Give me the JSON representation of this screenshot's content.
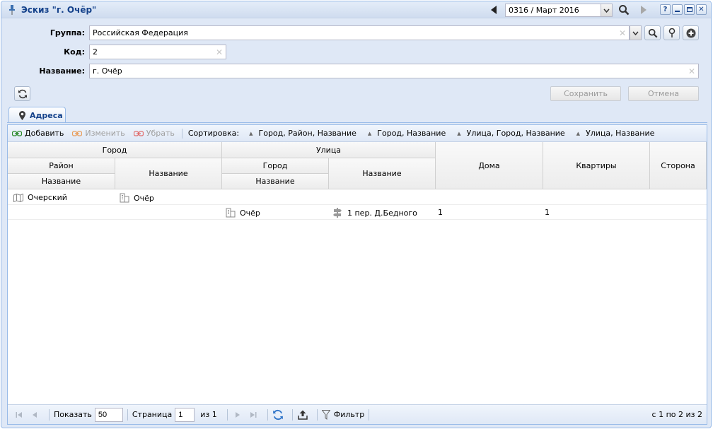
{
  "window": {
    "title": "Эскиз \"г. Очёр\"",
    "period": "0316 / Март 2016"
  },
  "form": {
    "group_label": "Группа:",
    "group_value": "Российская Федерация",
    "code_label": "Код:",
    "code_value": "2",
    "name_label": "Название:",
    "name_value": "г. Очёр",
    "save_label": "Сохранить",
    "cancel_label": "Отмена"
  },
  "tab": {
    "label": "Адреса"
  },
  "toolbar": {
    "add": "Добавить",
    "edit": "Изменить",
    "remove": "Убрать",
    "sort_label": "Сортировка:",
    "sort_options": [
      "Город, Район, Название",
      "Город, Название",
      "Улица, Город, Название",
      "Улица, Название"
    ]
  },
  "columns": {
    "city": "Город",
    "district": "Район",
    "district_name": "Название",
    "city_name": "Название",
    "street": "Улица",
    "street_city": "Город",
    "street_city_name": "Название",
    "street_name": "Название",
    "houses": "Дома",
    "apartments": "Квартиры",
    "side": "Сторона"
  },
  "rows": [
    {
      "district_name": "Очерский",
      "city_name": "Очёр"
    },
    {
      "street_city_name": "Очёр",
      "street_name": "1 пер. Д.Бедного",
      "houses": "1",
      "apartments": "1"
    }
  ],
  "pager": {
    "show_label": "Показать",
    "page_size": "50",
    "page_label": "Страница",
    "page_value": "1",
    "of_label": "из 1",
    "filter_label": "Фильтр",
    "summary": "с 1 по 2 из 2"
  }
}
